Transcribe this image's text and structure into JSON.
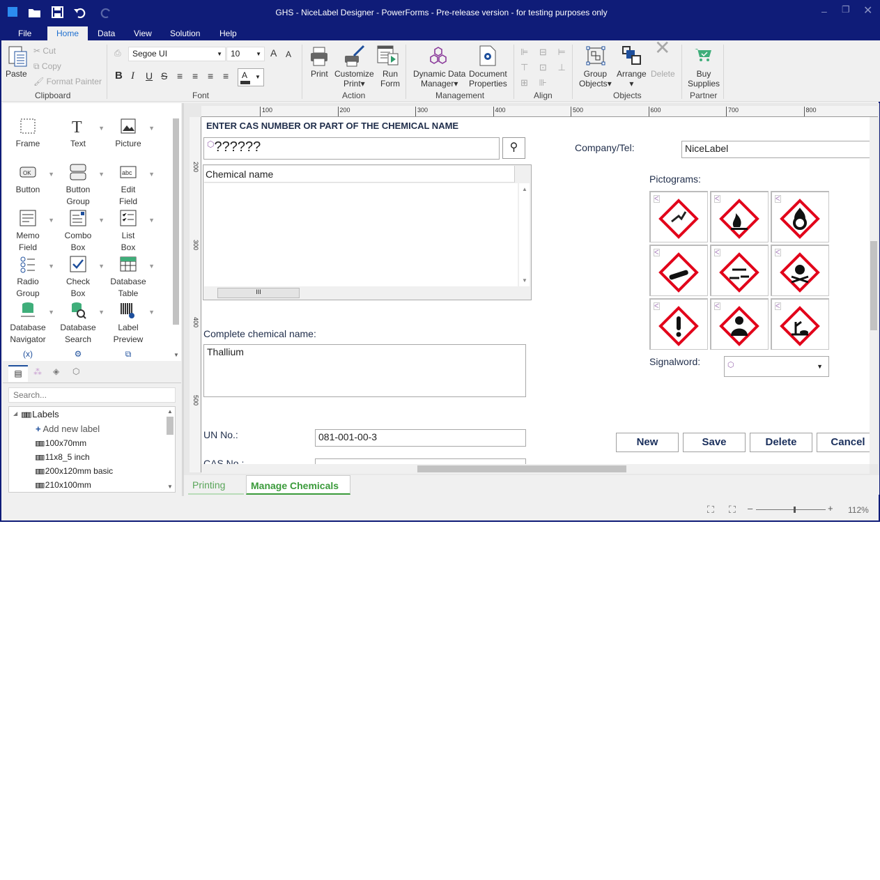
{
  "window": {
    "title": "GHS - NiceLabel Designer - PowerForms - Pre-release version - for testing purposes only",
    "accent": "#0f1c78"
  },
  "menu": [
    "File",
    "Home",
    "Data",
    "View",
    "Solution",
    "Help"
  ],
  "ribbon": {
    "clipboard": {
      "paste": "Paste",
      "cut": "Cut",
      "copy": "Copy",
      "format_painter": "Format Painter",
      "group": "Clipboard"
    },
    "font": {
      "family": "Segoe UI",
      "size": "10",
      "group": "Font",
      "bold": "B",
      "italic": "I",
      "underline": "U",
      "strike": "S",
      "color_letter": "A"
    },
    "action": {
      "print": "Print",
      "customize": "Customize",
      "customize2": "Print",
      "run": "Run",
      "run2": "Form",
      "group": "Action"
    },
    "management": {
      "ddm": "Dynamic Data",
      "ddm2": "Manager",
      "docprops": "Document",
      "docprops2": "Properties",
      "group": "Management"
    },
    "align": {
      "group": "Align"
    },
    "objects": {
      "group_obj": "Group",
      "group_obj2": "Objects",
      "arrange": "Arrange",
      "delete": "Delete",
      "group": "Objects"
    },
    "partner": {
      "buy": "Buy",
      "buy2": "Supplies",
      "group": "Partner"
    }
  },
  "toolbox": [
    {
      "l1": "Frame",
      "l2": "",
      "icon": "frame-icon"
    },
    {
      "l1": "Text",
      "l2": "",
      "icon": "text-icon"
    },
    {
      "l1": "Picture",
      "l2": "",
      "icon": "picture-icon"
    },
    {
      "l1": "Button",
      "l2": "",
      "icon": "button-icon"
    },
    {
      "l1": "Button",
      "l2": "Group",
      "icon": "button-group-icon"
    },
    {
      "l1": "Edit",
      "l2": "Field",
      "icon": "edit-field-icon"
    },
    {
      "l1": "Memo",
      "l2": "Field",
      "icon": "memo-field-icon"
    },
    {
      "l1": "Combo",
      "l2": "Box",
      "icon": "combo-box-icon"
    },
    {
      "l1": "List",
      "l2": "Box",
      "icon": "list-box-icon"
    },
    {
      "l1": "Radio",
      "l2": "Group",
      "icon": "radio-group-icon"
    },
    {
      "l1": "Check",
      "l2": "Box",
      "icon": "check-box-icon"
    },
    {
      "l1": "Database",
      "l2": "Table",
      "icon": "database-table-icon"
    },
    {
      "l1": "Database",
      "l2": "Navigator",
      "icon": "database-navigator-icon"
    },
    {
      "l1": "Database",
      "l2": "Search",
      "icon": "database-search-icon"
    },
    {
      "l1": "Label",
      "l2": "Preview",
      "icon": "label-preview-icon"
    }
  ],
  "explorer": {
    "search_placeholder": "Search...",
    "root": "Labels",
    "add": "Add new label",
    "labels": [
      "100x70mm",
      "11x8_5 inch",
      "200x120mm basic",
      "210x100mm"
    ]
  },
  "ruler": {
    "h": [
      "100",
      "200",
      "300",
      "400",
      "500",
      "600",
      "700",
      "800"
    ],
    "v": [
      "200",
      "300",
      "400",
      "500"
    ]
  },
  "form": {
    "heading": "ENTER CAS NUMBER OR PART OF THE CHEMICAL NAME",
    "search_value": "??????",
    "list_header": "Chemical name",
    "complete_label": "Complete chemical name:",
    "complete_value": "Thallium",
    "un_label": "UN No.:",
    "un_value": "081-001-00-3",
    "cas_label": "CAS No.:",
    "company_label": "Company/Tel:",
    "company_value": "NiceLabel",
    "pictograms_label": "Pictograms:",
    "pictograms": [
      "explosive",
      "flammable",
      "oxidizing",
      "gas-cylinder",
      "corrosive",
      "toxic",
      "exclamation",
      "health-hazard",
      "environment"
    ],
    "signal_label": "Signalword:",
    "signal_value": "",
    "buttons": [
      "New",
      "Save",
      "Delete",
      "Cancel"
    ]
  },
  "doc_tabs": [
    {
      "label": "Printing",
      "active": false
    },
    {
      "label": "Manage Chemicals",
      "active": true
    }
  ],
  "status": {
    "zoom": "112%",
    "zoom_level": 112
  }
}
